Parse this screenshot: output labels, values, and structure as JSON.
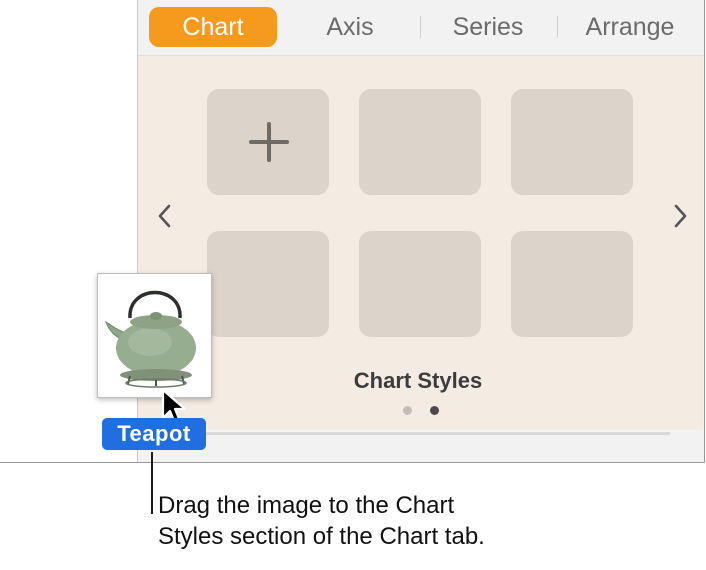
{
  "tabs": [
    {
      "label": "Chart",
      "active": true
    },
    {
      "label": "Axis",
      "active": false
    },
    {
      "label": "Series",
      "active": false
    },
    {
      "label": "Arrange",
      "active": false
    }
  ],
  "chart_styles": {
    "section_label": "Chart Styles",
    "add_icon": "plus-icon",
    "tile_count_visible": 6,
    "pages": 2,
    "current_page": 2,
    "prev_icon": "chevron-left-icon",
    "next_icon": "chevron-right-icon"
  },
  "dragged_item": {
    "label": "Teapot",
    "image": "teapot-image"
  },
  "callout": {
    "text": "Drag the image to the Chart\nStyles section of the Chart tab."
  },
  "colors": {
    "active_tab": "#f59a1c",
    "panel_background": "#f4ebe2",
    "tile": "#dcd3cb",
    "drag_label": "#1f6fe0"
  }
}
